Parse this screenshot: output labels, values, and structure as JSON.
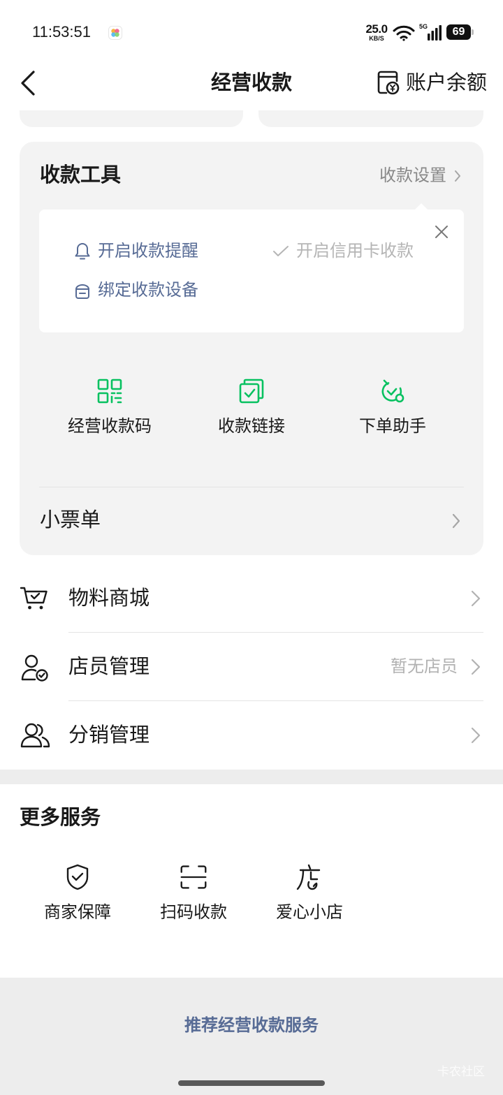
{
  "status_bar": {
    "time": "11:53:51",
    "app_icon": "photos-app-icon",
    "net_speed_value": "25.0",
    "net_speed_unit": "KB/S",
    "network_type": "5G",
    "battery": "69"
  },
  "header": {
    "back_icon": "chevron-left-icon",
    "title": "经营收款",
    "balance_icon": "wallet-icon",
    "balance_label": "账户余额"
  },
  "collection_tools": {
    "title": "收款工具",
    "settings_label": "收款设置",
    "popup": {
      "close_icon": "close-icon",
      "items": [
        {
          "icon": "bell-icon",
          "label": "开启收款提醒",
          "enabled": true
        },
        {
          "icon": "check-icon",
          "label": "开启信用卡收款",
          "enabled": false
        },
        {
          "icon": "device-icon",
          "label": "绑定收款设备",
          "enabled": true
        }
      ]
    },
    "tools": [
      {
        "icon": "qr-code-icon",
        "label": "经营收款码"
      },
      {
        "icon": "payment-link-icon",
        "label": "收款链接"
      },
      {
        "icon": "order-assistant-icon",
        "label": "下单助手"
      }
    ],
    "receipt_label": "小票单"
  },
  "menu": [
    {
      "icon": "cart-icon",
      "label": "物料商城",
      "value": ""
    },
    {
      "icon": "staff-icon",
      "label": "店员管理",
      "value": "暂无店员"
    },
    {
      "icon": "distribution-icon",
      "label": "分销管理",
      "value": ""
    }
  ],
  "more_services": {
    "title": "更多服务",
    "items": [
      {
        "icon": "shield-check-icon",
        "label": "商家保障"
      },
      {
        "icon": "scan-icon",
        "label": "扫码收款"
      },
      {
        "icon": "store-icon",
        "label": "爱心小店"
      }
    ]
  },
  "footer": {
    "recommend_label": "推荐经营收款服务",
    "watermark": "卡农社区"
  },
  "colors": {
    "accent_green": "#07c160",
    "link_blue": "#576b95",
    "text_primary": "#191919",
    "text_secondary": "#888888",
    "text_disabled": "#b5b5b5",
    "card_bg": "#f3f3f3",
    "section_bg": "#ededed"
  }
}
